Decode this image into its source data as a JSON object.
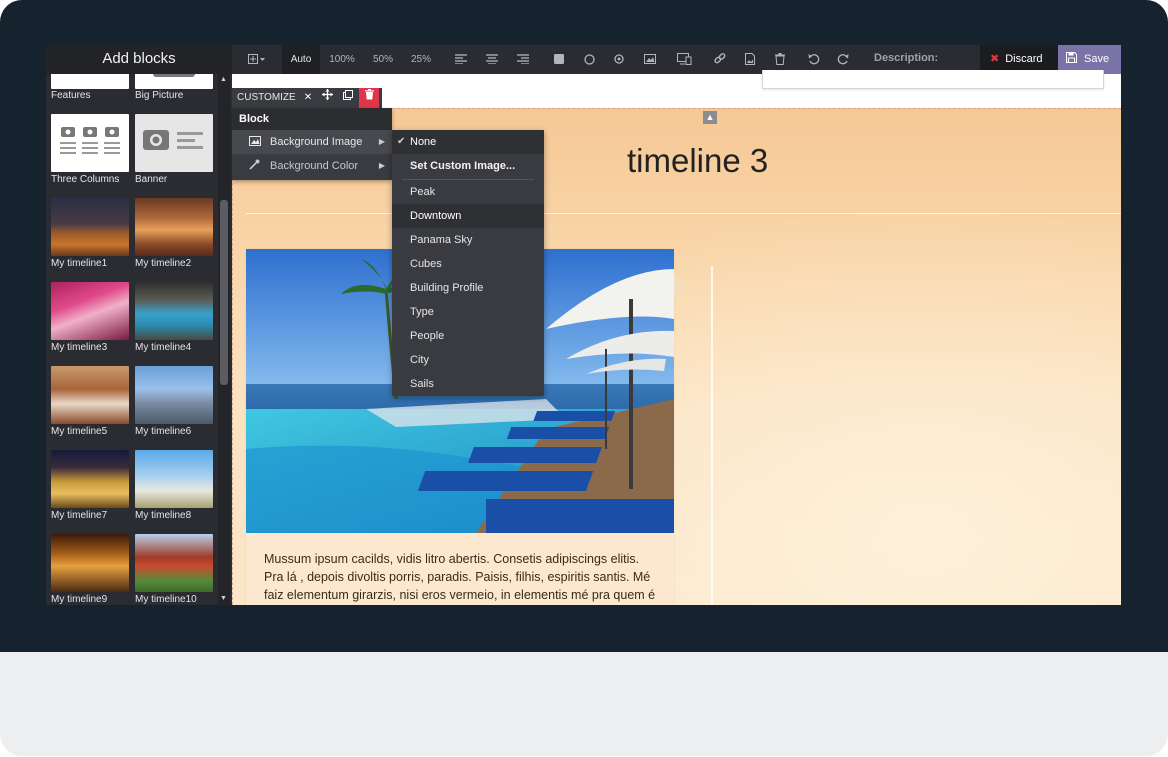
{
  "toolbar": {
    "title": "Add blocks",
    "auto": "Auto",
    "zoom_100": "100%",
    "zoom_50": "50%",
    "zoom_25": "25%",
    "description_label": "Description:",
    "discard": "Discard",
    "save": "Save"
  },
  "sidebar": {
    "items": [
      {
        "label": "Features"
      },
      {
        "label": "Big Picture"
      },
      {
        "label": "Three Columns"
      },
      {
        "label": "Banner"
      },
      {
        "label": "My timeline1"
      },
      {
        "label": "My timeline2"
      },
      {
        "label": "My timeline3"
      },
      {
        "label": "My timeline4"
      },
      {
        "label": "My timeline5"
      },
      {
        "label": "My timeline6"
      },
      {
        "label": "My timeline7"
      },
      {
        "label": "My timeline8"
      },
      {
        "label": "My timeline9"
      },
      {
        "label": "My timeline10"
      }
    ]
  },
  "customize": {
    "label": "CUSTOMIZE",
    "close": "✕"
  },
  "block_menu": {
    "header": "Block",
    "background_image": "Background Image",
    "background_color": "Background Color"
  },
  "background_submenu": {
    "none": "None",
    "set_custom": "Set Custom Image...",
    "options": [
      "Peak",
      "Downtown",
      "Panama Sky",
      "Cubes",
      "Building Profile",
      "Type",
      "People",
      "City",
      "Sails"
    ],
    "highlighted": "Downtown"
  },
  "page": {
    "title": "timeline 3",
    "body_line1": "Mussum ipsum cacilds, vidis litro abertis. Consetis adipiscings elitis.",
    "body_line2": "Pra lá , depois divoltis porris, paradis. Paisis, filhis, espiritis santis. Mé",
    "body_line3": "faiz elementum girarzis, nisi eros vermeio, in elementis mé pra quem é"
  },
  "colors": {
    "bezel": "#16222e",
    "toolbar": "#2b2c31",
    "save": "#7a73a8",
    "discard_icon": "#e0343f",
    "delete": "#e0354a"
  }
}
